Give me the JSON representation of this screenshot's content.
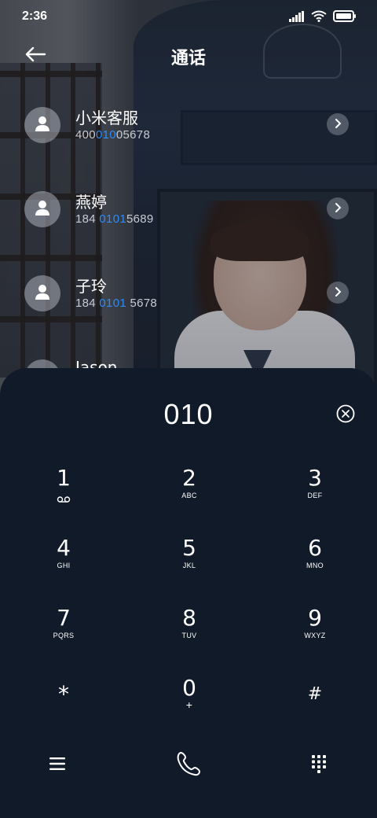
{
  "status_bar": {
    "time": "2:36",
    "icons": [
      "signal-icon",
      "wifi-icon",
      "battery-icon"
    ]
  },
  "header": {
    "title": "通话",
    "back_icon": "back-arrow-icon"
  },
  "contacts": [
    {
      "name": "小米客服",
      "number_pre": "400",
      "number_match": "010",
      "number_post": "05678"
    },
    {
      "name": "燕婷",
      "number_pre": "184 ",
      "number_match": "0101",
      "number_post": "5689"
    },
    {
      "name": "子玲",
      "number_pre": "184 ",
      "number_match": "0101",
      "number_post": " 5678"
    },
    {
      "name": "Jason"
    }
  ],
  "dialpad": {
    "input_value": "010",
    "keys": [
      {
        "digit": "1",
        "letters": "",
        "sub_icon": "voicemail-icon"
      },
      {
        "digit": "2",
        "letters": "ABC"
      },
      {
        "digit": "3",
        "letters": "DEF"
      },
      {
        "digit": "4",
        "letters": "GHI"
      },
      {
        "digit": "5",
        "letters": "JKL"
      },
      {
        "digit": "6",
        "letters": "MNO"
      },
      {
        "digit": "7",
        "letters": "PQRS"
      },
      {
        "digit": "8",
        "letters": "TUV"
      },
      {
        "digit": "9",
        "letters": "WXYZ"
      },
      {
        "digit": "*",
        "letters": ""
      },
      {
        "digit": "0",
        "letters": "+"
      },
      {
        "digit": "#",
        "letters": ""
      }
    ],
    "bottom_icons": [
      "menu-icon",
      "call-icon",
      "dialpad-toggle-icon"
    ]
  },
  "colors": {
    "panel_bg": "#111a29",
    "match_highlight": "#2f8cf5",
    "text_primary": "#ffffff"
  }
}
